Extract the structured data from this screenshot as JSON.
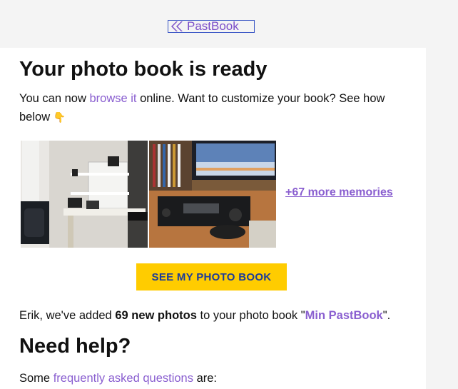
{
  "brand": {
    "name": "PastBook",
    "color": "#7c4fc9",
    "accent": "#ffcc00"
  },
  "header": {
    "title": "Your photo book is ready"
  },
  "intro": {
    "before": "You can now ",
    "link": "browse it",
    "after_line1": " online. Want to customize your book? See how",
    "after_line2": "below ",
    "pointer_glyph": "👇"
  },
  "gallery": {
    "photos": [
      {
        "alt": "desk with radio equipment"
      },
      {
        "alt": "ham radio transceiver"
      }
    ],
    "more_link": "+67 more memories"
  },
  "cta": {
    "label": "SEE MY PHOTO BOOK"
  },
  "added": {
    "prefix": "Erik, we've added ",
    "count_text": "69 new photos",
    "middle": " to your photo book \"",
    "book_name": "Min PastBook",
    "suffix": "\"."
  },
  "help": {
    "title": "Need help?",
    "prefix": "Some ",
    "link": "frequently asked questions",
    "suffix": " are:"
  }
}
